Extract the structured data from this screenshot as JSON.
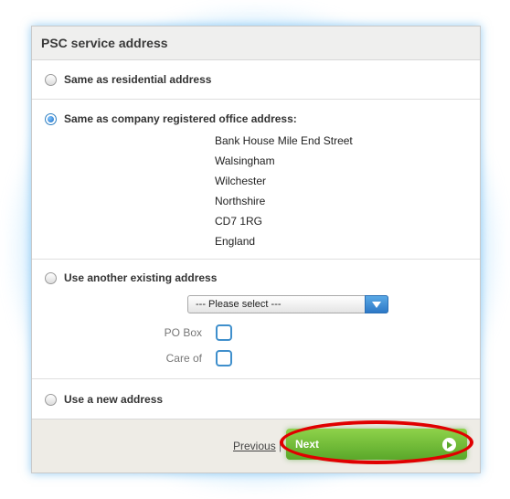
{
  "panel": {
    "title": "PSC service address"
  },
  "options": {
    "residential": {
      "label": "Same as residential address",
      "checked": false
    },
    "registered_office": {
      "label": "Same as company registered office address:",
      "checked": true,
      "address_lines": [
        "Bank House Mile End Street",
        "Walsingham",
        "Wilchester",
        "Northshire",
        "CD7 1RG",
        "England"
      ]
    },
    "existing": {
      "label": "Use another existing address",
      "checked": false,
      "select_value": "--- Please select ---",
      "po_box_label": "PO Box",
      "care_of_label": "Care of"
    },
    "new_address": {
      "label": "Use a new address",
      "checked": false
    }
  },
  "footer": {
    "previous_label": "Previous",
    "separator": "|",
    "next_label": "Next"
  },
  "colors": {
    "accent_blue": "#2f7fc0",
    "next_green": "#6bbb34",
    "annotation_red": "#e00000"
  }
}
